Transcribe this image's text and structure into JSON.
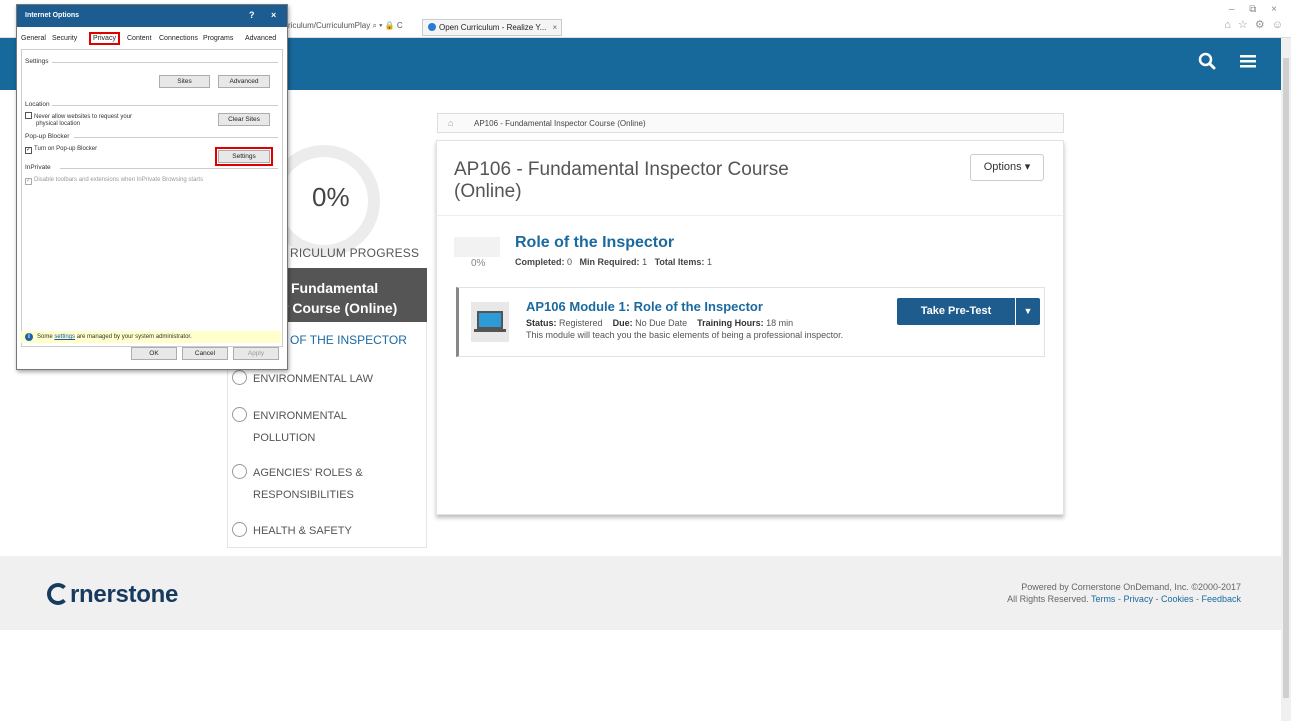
{
  "browser": {
    "address_text": "riculum/CurriculumPlay ⌕ ▾ 🔒 C",
    "tab_title": "Open Curriculum - Realize Y...",
    "tab_close": "×",
    "window_controls": "–  ⧉  ×",
    "fav_icons": "⌂ ☆ ⚙ ☺"
  },
  "app_header": {
    "search_icon": "search-icon",
    "menu_icon": "hamburger-menu-icon",
    "color": "#17689b"
  },
  "sidebar": {
    "progress_pct": "0%",
    "progress_label": "RICULUM PROGRESS",
    "course_title_line1": "Fundamental",
    "course_title_line2": "r Course (Online)",
    "active_item": "OF THE INSPECTOR",
    "items": [
      {
        "line1": "ENVIRONMENTAL LAW",
        "line2": ""
      },
      {
        "line1": "ENVIRONMENTAL",
        "line2": "POLLUTION"
      },
      {
        "line1": "AGENCIES' ROLES &",
        "line2": "RESPONSIBILITIES"
      },
      {
        "line1": "HEALTH & SAFETY",
        "line2": ""
      }
    ]
  },
  "main": {
    "breadcrumb": "AP106 - Fundamental Inspector Course (Online)",
    "title_line1": "AP106 - Fundamental Inspector Course",
    "title_line2": "(Online)",
    "options_label": "Options ▾",
    "section": {
      "pct": "0%",
      "title": "Role of the Inspector",
      "completed_label": "Completed:",
      "completed_value": "0",
      "min_required_label": "Min Required:",
      "min_required_value": "1",
      "total_items_label": "Total Items:",
      "total_items_value": "1"
    },
    "module": {
      "title": "AP106 Module 1: Role of the Inspector",
      "status_label": "Status:",
      "status_value": "Registered",
      "due_label": "Due:",
      "due_value": "No Due Date",
      "hours_label": "Training Hours:",
      "hours_value": "18 min",
      "description": "This module will teach you the basic elements of being a professional inspector.",
      "action_label": "Take Pre-Test",
      "action_caret": "▼"
    }
  },
  "footer": {
    "logo_text": "rnerstone",
    "powered_line1": "Powered by Cornerstone OnDemand, Inc. ©2000-2017",
    "powered_line2_prefix": "All Rights Reserved. ",
    "link_terms": "Terms",
    "link_privacy": "Privacy",
    "link_cookies": "Cookies",
    "link_feedback": "Feedback",
    "sep": " - "
  },
  "dialog": {
    "title": "Internet Options",
    "help": "?",
    "close": "×",
    "tabs": [
      "General",
      "Security",
      "Privacy",
      "Content",
      "Connections",
      "Programs",
      "Advanced"
    ],
    "selected_tab": "Privacy",
    "settings_group": "Settings",
    "sites_button": "Sites",
    "advanced_button": "Advanced",
    "location_group": "Location",
    "location_check_line1": "Never allow websites to request your",
    "location_check_line2": "physical location",
    "clear_sites_button": "Clear Sites",
    "popup_group": "Pop-up Blocker",
    "popup_check": "Turn on Pop-up Blocker",
    "popup_settings_button": "Settings",
    "inprivate_group": "InPrivate",
    "inprivate_check": "Disable toolbars and extensions when InPrivate Browsing starts",
    "notice_prefix": "Some ",
    "notice_link": "settings",
    "notice_suffix": " are managed by your system administrator.",
    "ok_button": "OK",
    "cancel_button": "Cancel",
    "apply_button": "Apply"
  }
}
